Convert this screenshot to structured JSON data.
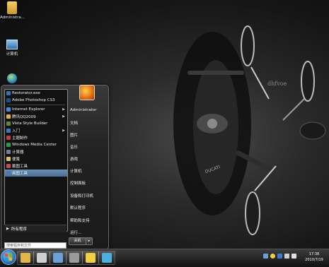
{
  "desktop": {
    "icons": [
      {
        "label": "Administra..."
      },
      {
        "label": "计算机"
      }
    ],
    "watermark": "dhfvoe"
  },
  "start_menu": {
    "programs": [
      {
        "label": "Restorator.exe",
        "color": "#3b6fb5",
        "arrow": false,
        "selected": false
      },
      {
        "label": "Adobe Photoshop CS3",
        "color": "#1b4f8a",
        "arrow": false,
        "selected": false
      },
      {
        "label": "Internet Explorer",
        "color": "#3d8ee0",
        "arrow": true,
        "selected": false
      },
      {
        "label": "腾讯QQ2009",
        "color": "#e0b23a",
        "arrow": true,
        "selected": false
      },
      {
        "label": "Vista Style Builder",
        "color": "#5a8a3a",
        "arrow": false,
        "selected": false
      },
      {
        "label": "入门",
        "color": "#3a7ac0",
        "arrow": true,
        "selected": false
      },
      {
        "label": "主题制作",
        "color": "#c04040",
        "arrow": false,
        "selected": false
      },
      {
        "label": "Windows Media Center",
        "color": "#2c9a4a",
        "arrow": false,
        "selected": false
      },
      {
        "label": "计算器",
        "color": "#7a7a9a",
        "arrow": false,
        "selected": false
      },
      {
        "label": "便笺",
        "color": "#d8c85a",
        "arrow": false,
        "selected": false
      },
      {
        "label": "截图工具",
        "color": "#c05050",
        "arrow": false,
        "selected": false
      },
      {
        "label": "画图工具",
        "color": "#4a7ab0",
        "arrow": false,
        "selected": true
      }
    ],
    "all_programs": "所有程序",
    "search_placeholder": "搜索程序和文件",
    "right_links": [
      {
        "label": "Administrator"
      },
      {
        "label": "文档"
      },
      {
        "label": "图片"
      },
      {
        "label": "音乐"
      },
      {
        "label": "游戏"
      },
      {
        "label": "计算机"
      },
      {
        "label": "控制面板"
      },
      {
        "label": "设备和打印机"
      },
      {
        "label": "默认程序"
      },
      {
        "label": "帮助和支持"
      },
      {
        "label": "运行..."
      }
    ],
    "shutdown": "关机"
  },
  "taskbar": {
    "items": [
      {
        "icon": "folder-icon",
        "color": "#e0b84a"
      },
      {
        "icon": "brush-icon",
        "color": "#d0d0d0"
      },
      {
        "icon": "monitor-icon",
        "color": "#6aa0d8"
      },
      {
        "icon": "gear-icon",
        "color": "#9a9a9a"
      },
      {
        "icon": "penguin-icon",
        "color": "#f0d040"
      },
      {
        "icon": "swirl-icon",
        "color": "#4ab0e0"
      }
    ],
    "time": "17:38",
    "date": "2010/7/19"
  }
}
